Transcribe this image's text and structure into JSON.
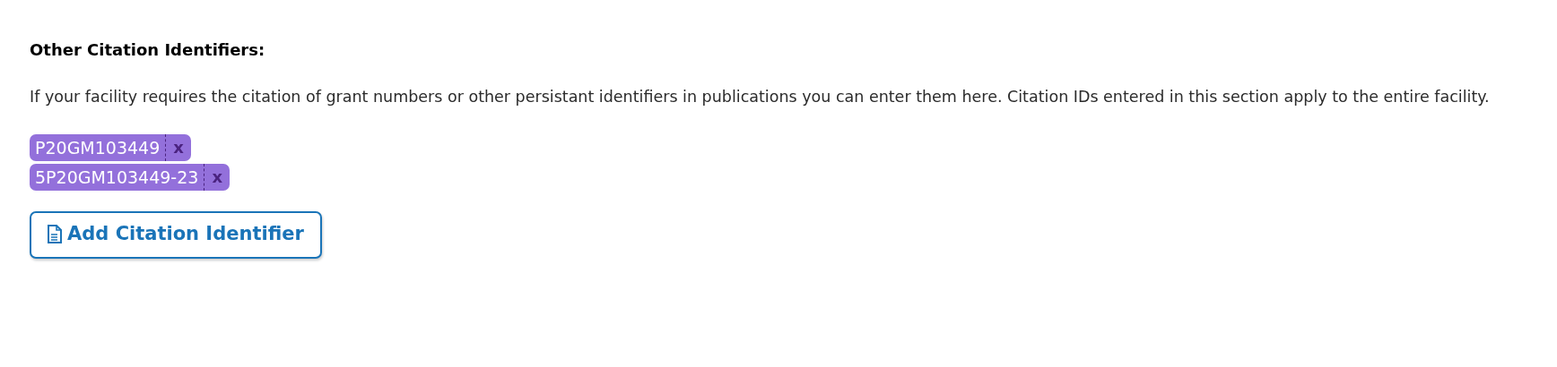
{
  "heading": "Other Citation Identifiers:",
  "description": "If your facility requires the citation of grant numbers or other persistant identifiers in publications you can enter them here. Citation IDs entered in this section apply to the entire facility.",
  "tags": [
    {
      "label": "P20GM103449",
      "remove": "x"
    },
    {
      "label": "5P20GM103449-23",
      "remove": "x"
    }
  ],
  "add_button": {
    "label": "Add Citation Identifier"
  }
}
